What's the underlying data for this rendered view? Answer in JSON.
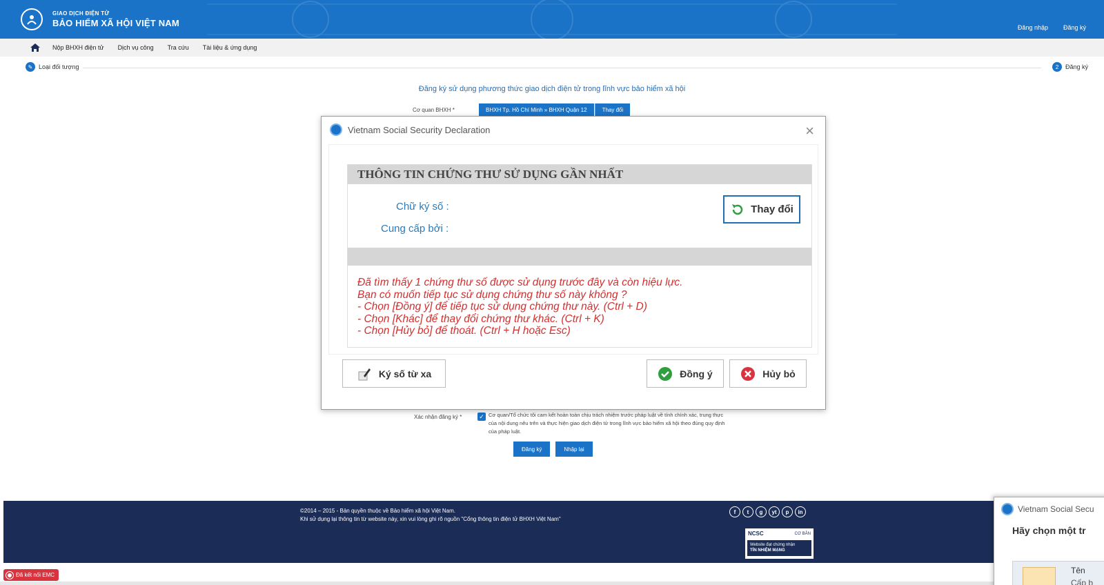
{
  "header": {
    "brand_top": "GIAO DỊCH ĐIỆN TỬ",
    "brand_main": "BẢO HIỂM XÃ HỘI VIỆT NAM",
    "login": "Đăng nhập",
    "register": "Đăng ký"
  },
  "nav": {
    "items": [
      {
        "label": "Nộp BHXH điện tử"
      },
      {
        "label": "Dịch vụ công"
      },
      {
        "label": "Tra cứu"
      },
      {
        "label": "Tài liệu & ứng dụng"
      }
    ]
  },
  "steps": {
    "step1": "Loại đối tượng",
    "step2_num": "2",
    "step2": "Đăng ký"
  },
  "page": {
    "title": "Đăng ký sử dụng phương thức giao dịch điện tử trong lĩnh vực bảo hiểm xã hội",
    "agency_label": "Cơ quan BHXH *",
    "agency_value": "BHXH Tp. Hồ Chí Minh » BHXH Quận 12",
    "agency_change": "Thay đổi",
    "confirm_label": "Xác nhận đăng ký *",
    "confirm_text": "Cơ quan/Tổ chức tôi cam kết hoàn toàn chịu trách nhiệm trước pháp luật về tính chính xác, trung thực của nội dung nêu trên và thực hiện giao dịch điện tử trong lĩnh vực bảo hiểm xã hội theo đúng quy định của pháp luật.",
    "submit": "Đăng ký",
    "reset": "Nhập lại"
  },
  "footer": {
    "line1": "©2014 – 2015 - Bản quyền thuộc về Bảo hiểm xã hội Việt Nam.",
    "line2": "Khi sử dụng lại thông tin từ website này, xin vui lòng ghi rõ nguồn \"Cổng thông tin điện tử BHXH Việt Nam\"",
    "socials": [
      "f",
      "t",
      "g",
      "yt",
      "p",
      "in"
    ],
    "ncsc_logo": "NCSC",
    "ncsc_level": "CƠ BẢN",
    "ncsc_line1": "Website đạt chứng nhận",
    "ncsc_line2": "TÍN NHIỆM MẠNG"
  },
  "emc": {
    "label": "Đã kết nối EMC"
  },
  "modal": {
    "title": "Vietnam Social Security Declaration",
    "close": "×",
    "header": "THÔNG TIN CHỨNG THƯ SỬ DỤNG GẦN NHẤT",
    "signature_label": "Chữ ký số :",
    "provider_label": "Cung cấp bởi :",
    "change_button": "Thay đổi",
    "messages": [
      "Đã tìm thấy 1 chứng thư số được sử dụng trước đây và còn hiệu lực.",
      "Bạn có muốn tiếp tục sử dụng chứng thư số này không ?",
      "- Chọn [Đồng ý] để tiếp tục sử dụng chứng thư này.  (Ctrl + D)",
      "- Chọn [Khác] để thay đổi chứng thư khác. (Ctrl + K)",
      "- Chọn [Hủy bỏ] để thoát. (Ctrl + H hoặc Esc)"
    ],
    "remote_sign_button": "Ký số từ xa",
    "agree_button": "Đồng ý",
    "cancel_button": "Hủy bỏ"
  },
  "modal2": {
    "title": "Vietnam Social Secu",
    "heading": "Hãy chọn một tr",
    "name_label": "Tên",
    "sub_label": "Cấp b"
  },
  "colors": {
    "primary": "#1a73c7",
    "footer": "#1b2d57",
    "warning_text": "#d32f2f",
    "label_blue": "#2a7ab8"
  }
}
